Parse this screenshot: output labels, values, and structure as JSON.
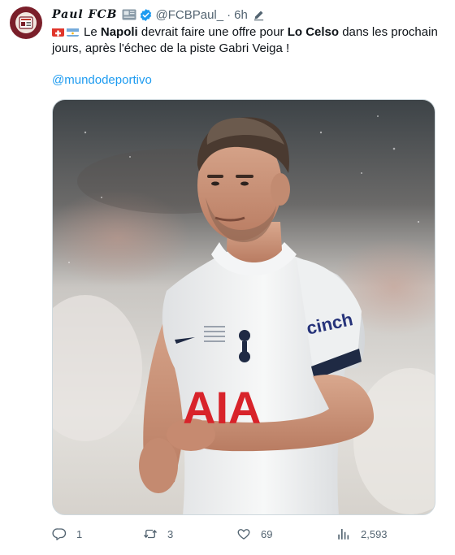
{
  "author": {
    "display_name": "Paul FCB",
    "handle": "@FCBPaul_",
    "separator": "·",
    "time": "6h"
  },
  "tweet": {
    "line1": {
      "t1": "Le ",
      "b1": "Napoli",
      "t2": " devrait faire une offre pour ",
      "b2": "Lo Celso",
      "t3": " dans les prochain"
    },
    "line2": "jours, après l'échec de la piste Gabri Veiga !",
    "mention": "@mundodeportivo"
  },
  "media": {
    "kit": {
      "sponsor_chest": "AIA",
      "sponsor_sleeve": "cinch"
    }
  },
  "actions": {
    "replies": "1",
    "reposts": "3",
    "likes": "69",
    "views": "2,593"
  },
  "colors": {
    "link": "#1d9bf0",
    "secondary_text": "#536471",
    "verified": "#1d9bf0",
    "avatar_bg": "#7a1f2a"
  },
  "icons": [
    "newspaper-icon",
    "news-badge-icon",
    "verified-icon",
    "edit-icon",
    "reply-icon",
    "repost-icon",
    "like-icon",
    "views-icon"
  ]
}
